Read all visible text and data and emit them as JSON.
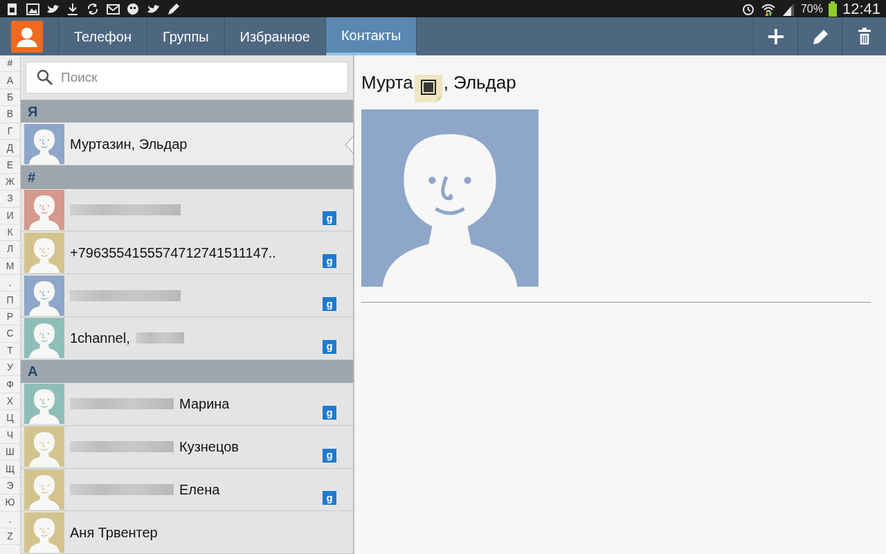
{
  "status_bar": {
    "battery": "70%",
    "time": "12:41"
  },
  "tabs": [
    {
      "label": "Телефон",
      "selected": false
    },
    {
      "label": "Группы",
      "selected": false
    },
    {
      "label": "Избранное",
      "selected": false
    },
    {
      "label": "Контакты",
      "selected": true
    }
  ],
  "index_letters": [
    "#",
    "А",
    "Б",
    "В",
    "Г",
    "Д",
    "Е",
    "Ж",
    "З",
    "И",
    "К",
    "Л",
    "М",
    ".",
    "П",
    "Р",
    "С",
    "Т",
    "У",
    "Ф",
    "Х",
    "Ц",
    "Ч",
    "Ш",
    "Щ",
    "Э",
    "Ю",
    ".",
    "Z"
  ],
  "search": {
    "placeholder": "Поиск"
  },
  "sections": [
    {
      "header": "Я",
      "contacts": [
        {
          "kind": "plain",
          "name": "Муртазин, Эльдар",
          "color": "#8ea6c9",
          "selected": true
        }
      ]
    },
    {
      "header": "#",
      "contacts": [
        {
          "kind": "redacted_only",
          "color": "#d49a8c",
          "selected": false,
          "badge": "g"
        },
        {
          "kind": "plain",
          "name": "+7963554155574712741511147..",
          "color": "#d3c48e",
          "selected": false,
          "badge": "g"
        },
        {
          "kind": "redacted_only",
          "color": "#8ea6c9",
          "selected": false,
          "badge": "g"
        },
        {
          "kind": "redacted_after",
          "name": "1channel,",
          "color": "#8fbdb8",
          "selected": false,
          "badge": "g"
        }
      ]
    },
    {
      "header": "А",
      "contacts": [
        {
          "kind": "redacted_before",
          "name": "Марина",
          "color": "#8fbdb8",
          "selected": false,
          "badge": "g"
        },
        {
          "kind": "redacted_before",
          "name": "Кузнецов",
          "color": "#d3c48e",
          "selected": false,
          "badge": "g"
        },
        {
          "kind": "redacted_before",
          "name": "Елена",
          "color": "#d3c48e",
          "selected": false,
          "badge": "g"
        },
        {
          "kind": "plain",
          "name": "Аня Трвентер",
          "color": "#d3c48e",
          "selected": false
        }
      ]
    }
  ],
  "detail": {
    "name_parts": [
      "Мурта",
      ", Эльдар"
    ],
    "color": "#8ea6c9"
  }
}
